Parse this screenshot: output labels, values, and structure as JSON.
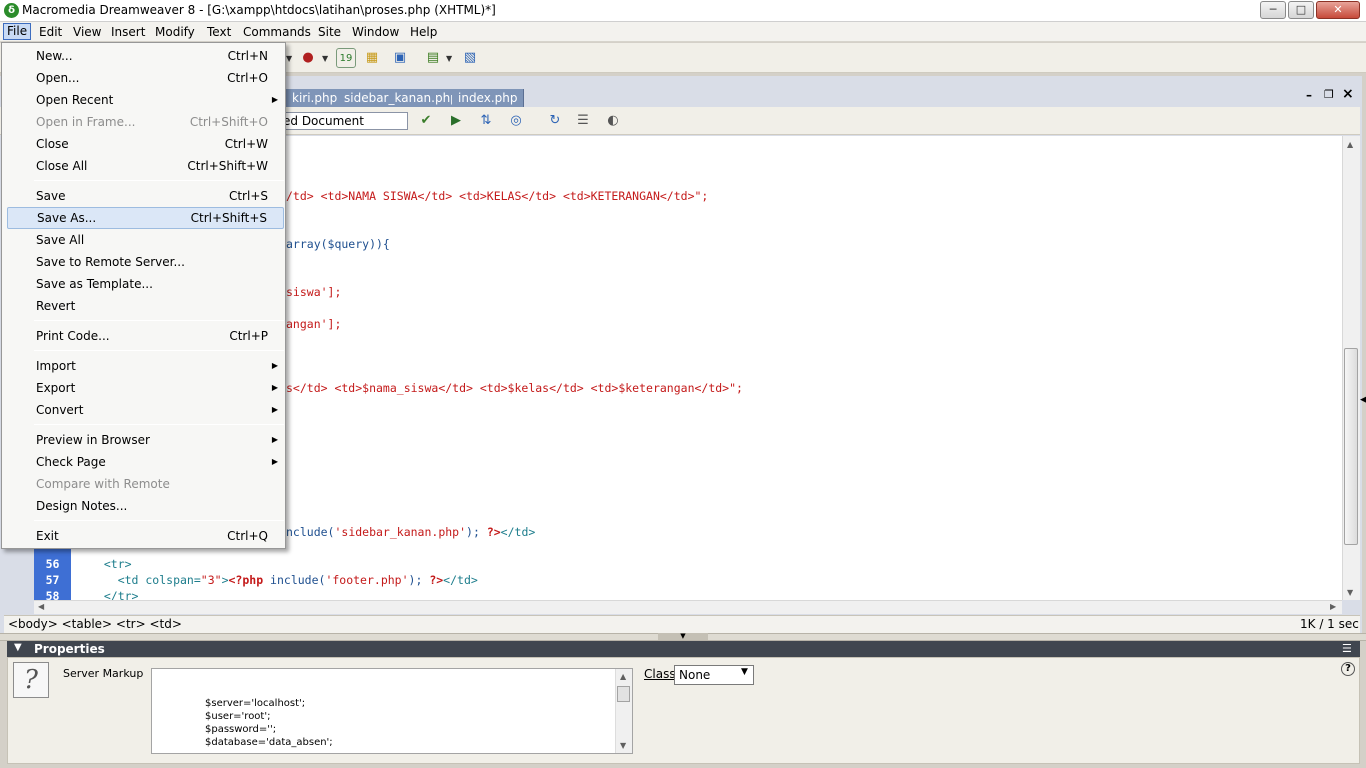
{
  "window": {
    "title": "Macromedia Dreamweaver 8 - [G:\\xampp\\htdocs\\latihan\\proses.php (XHTML)*]",
    "icon_glyph": "δ"
  },
  "menubar": {
    "items": [
      "File",
      "Edit",
      "View",
      "Insert",
      "Modify",
      "Text",
      "Commands",
      "Site",
      "Window",
      "Help"
    ]
  },
  "doc_tabs": [
    "kiri.php",
    "sidebar_kanan.php",
    "index.php"
  ],
  "title_field": "ed Document",
  "code_lines": [
    {
      "ln": "",
      "segs": [
        {
          "t": "/td> <td>NAMA SISWA</td> <td>KELAS</td> <td>KETERANGAN</td>\";",
          "c": "str"
        }
      ]
    },
    {
      "ln": "",
      "segs": [
        {
          "t": "array($query)){",
          "c": "fn"
        }
      ]
    },
    {
      "ln": "",
      "segs": [
        {
          "t": "siswa'];",
          "c": "str"
        }
      ]
    },
    {
      "ln": "",
      "segs": [
        {
          "t": "angan'];",
          "c": "str"
        }
      ]
    },
    {
      "ln": "",
      "segs": [
        {
          "t": "s</td> <td>$nama_siswa</td> <td>$kelas</td> <td>$keterangan</td>\";",
          "c": "str"
        }
      ]
    },
    {
      "ln": "",
      "segs": [
        {
          "t": "nclude(",
          "c": "fn"
        },
        {
          "t": "'sidebar_kanan.php'",
          "c": "str"
        },
        {
          "t": "); ",
          "c": "fn"
        },
        {
          "t": "?>",
          "c": "php"
        },
        {
          "t": "</td>",
          "c": "tag"
        }
      ]
    },
    {
      "ln": "56",
      "segs": [
        {
          "t": "  <tr>",
          "c": "tag"
        }
      ]
    },
    {
      "ln": "57",
      "segs": [
        {
          "t": "    <td colspan=",
          "c": "tag"
        },
        {
          "t": "\"3\"",
          "c": "str"
        },
        {
          "t": ">",
          "c": "tag"
        },
        {
          "t": "<?php",
          "c": "php"
        },
        {
          "t": " include(",
          "c": "fn"
        },
        {
          "t": "'footer.php'",
          "c": "str"
        },
        {
          "t": "); ",
          "c": "fn"
        },
        {
          "t": "?>",
          "c": "php"
        },
        {
          "t": "</td>",
          "c": "tag"
        }
      ]
    },
    {
      "ln": "58",
      "segs": [
        {
          "t": "  </tr>",
          "c": "tag"
        }
      ]
    }
  ],
  "status": {
    "tag_selector": "<body> <table> <tr> <td>",
    "right": "1K / 1 sec"
  },
  "properties": {
    "title": "Properties",
    "server_markup_label": "Server Markup",
    "markup_lines": [
      "$server='localhost';",
      "$user='root';",
      "$password='';",
      "$database='data_absen';"
    ],
    "class_label": "Class",
    "class_value": "None"
  },
  "file_menu": {
    "items": [
      {
        "label": "New...",
        "shortcut": "Ctrl+N"
      },
      {
        "label": "Open...",
        "shortcut": "Ctrl+O"
      },
      {
        "label": "Open Recent",
        "submenu": true
      },
      {
        "label": "Open in Frame...",
        "shortcut": "Ctrl+Shift+O",
        "disabled": true
      },
      {
        "label": "Close",
        "shortcut": "Ctrl+W"
      },
      {
        "label": "Close All",
        "shortcut": "Ctrl+Shift+W"
      },
      {
        "label": "Save",
        "shortcut": "Ctrl+S"
      },
      {
        "label": "Save As...",
        "shortcut": "Ctrl+Shift+S",
        "highlighted": true
      },
      {
        "label": "Save All"
      },
      {
        "label": "Save to Remote Server..."
      },
      {
        "label": "Save as Template..."
      },
      {
        "label": "Revert"
      },
      {
        "label": "Print Code...",
        "shortcut": "Ctrl+P"
      },
      {
        "label": "Import",
        "submenu": true
      },
      {
        "label": "Export",
        "submenu": true
      },
      {
        "label": "Convert",
        "submenu": true
      },
      {
        "label": "Preview in Browser",
        "submenu": true
      },
      {
        "label": "Check Page",
        "submenu": true
      },
      {
        "label": "Compare with Remote",
        "disabled": true
      },
      {
        "label": "Design Notes..."
      },
      {
        "label": "Exit",
        "shortcut": "Ctrl+Q"
      }
    ]
  },
  "colors": {
    "gutter": "#3e6fd4",
    "tab_bar": "#7f95b8",
    "properties_header": "#40464f",
    "menu_highlight": "#dbe7f7",
    "code_string": "#c41a1a",
    "code_tag": "#1d7d8c"
  }
}
